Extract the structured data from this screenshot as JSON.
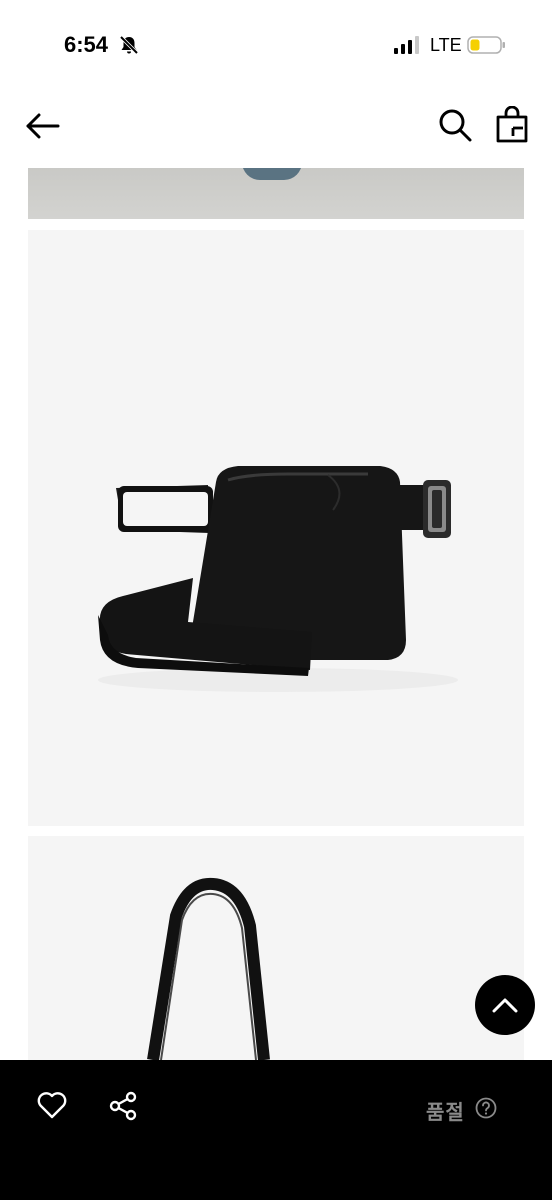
{
  "status_bar": {
    "time": "6:54",
    "network": "LTE"
  },
  "header": {
    "back_icon": "arrow-left-icon",
    "search_icon": "search-icon",
    "bag_icon": "shopping-bag-icon"
  },
  "gallery": {
    "images": [
      "product-photo-model-feet",
      "product-photo-black-crossbody-bag",
      "product-photo-black-shoulder-bag"
    ]
  },
  "bottom_bar": {
    "like_icon": "heart-icon",
    "share_icon": "share-icon",
    "status_label": "품절",
    "help_icon": "question-circle-icon"
  }
}
